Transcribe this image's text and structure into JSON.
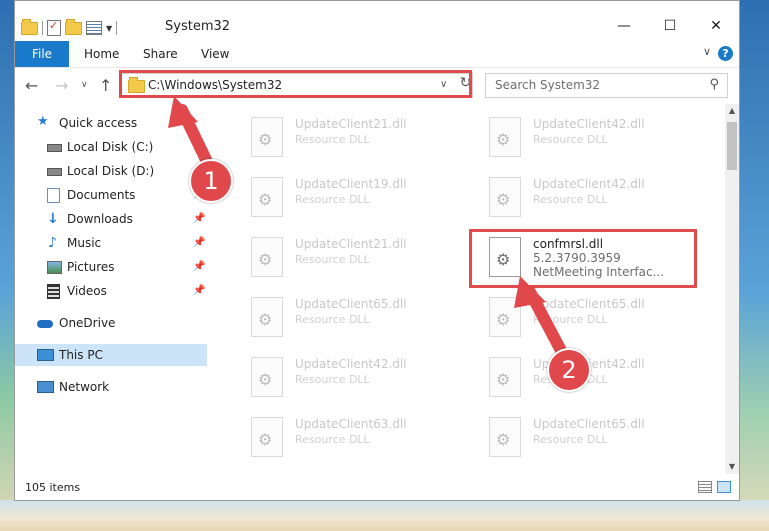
{
  "window": {
    "title": "System32",
    "controls": {
      "minimize": "—",
      "maximize": "☐",
      "close": "✕"
    }
  },
  "ribbon": {
    "file": "File",
    "tabs": [
      "Home",
      "Share",
      "View"
    ],
    "help": "?"
  },
  "navbar": {
    "address": "C:\\Windows\\System32",
    "search_placeholder": "Search System32"
  },
  "sidebar": {
    "items": [
      {
        "label": "Quick access",
        "icon": "star-icon"
      },
      {
        "label": "Local Disk (C:)",
        "icon": "drive-icon"
      },
      {
        "label": "Local Disk (D:)",
        "icon": "drive-icon"
      },
      {
        "label": "Documents",
        "icon": "documents-icon"
      },
      {
        "label": "Downloads",
        "icon": "download-arrow-icon"
      },
      {
        "label": "Music",
        "icon": "music-note-icon"
      },
      {
        "label": "Pictures",
        "icon": "picture-icon"
      },
      {
        "label": "Videos",
        "icon": "film-icon"
      },
      {
        "label": "OneDrive",
        "icon": "cloud-icon"
      },
      {
        "label": "This PC",
        "icon": "monitor-icon"
      },
      {
        "label": "Network",
        "icon": "network-icon"
      }
    ]
  },
  "files": {
    "left": [
      {
        "name": "UpdateClient21.dll",
        "type": "Resource DLL"
      },
      {
        "name": "UpdateClient19.dll",
        "type": "Resource DLL"
      },
      {
        "name": "UpdateClient21.dll",
        "type": "Resource DLL"
      },
      {
        "name": "UpdateClient65.dll",
        "type": "Resource DLL"
      },
      {
        "name": "UpdateClient42.dll",
        "type": "Resource DLL"
      },
      {
        "name": "UpdateClient63.dll",
        "type": "Resource DLL"
      }
    ],
    "right": [
      {
        "name": "UpdateClient42.dll",
        "type": "Resource DLL"
      },
      {
        "name": "UpdateClient42.dll",
        "type": "Resource DLL"
      },
      {
        "name": "UpdateClient65.dll",
        "type": "Resource DLL"
      },
      {
        "name": "UpdateClient42.dll",
        "type": "Resource DLL"
      },
      {
        "name": "UpdateClient65.dll",
        "type": "Resource DLL"
      }
    ],
    "highlighted": {
      "name": "confmrsl.dll",
      "version": "5.2.3790.3959",
      "description": "NetMeeting Interfac..."
    }
  },
  "status": {
    "count": "105 items"
  },
  "callouts": {
    "step1": "1",
    "step2": "2",
    "color": "#e0484c"
  }
}
